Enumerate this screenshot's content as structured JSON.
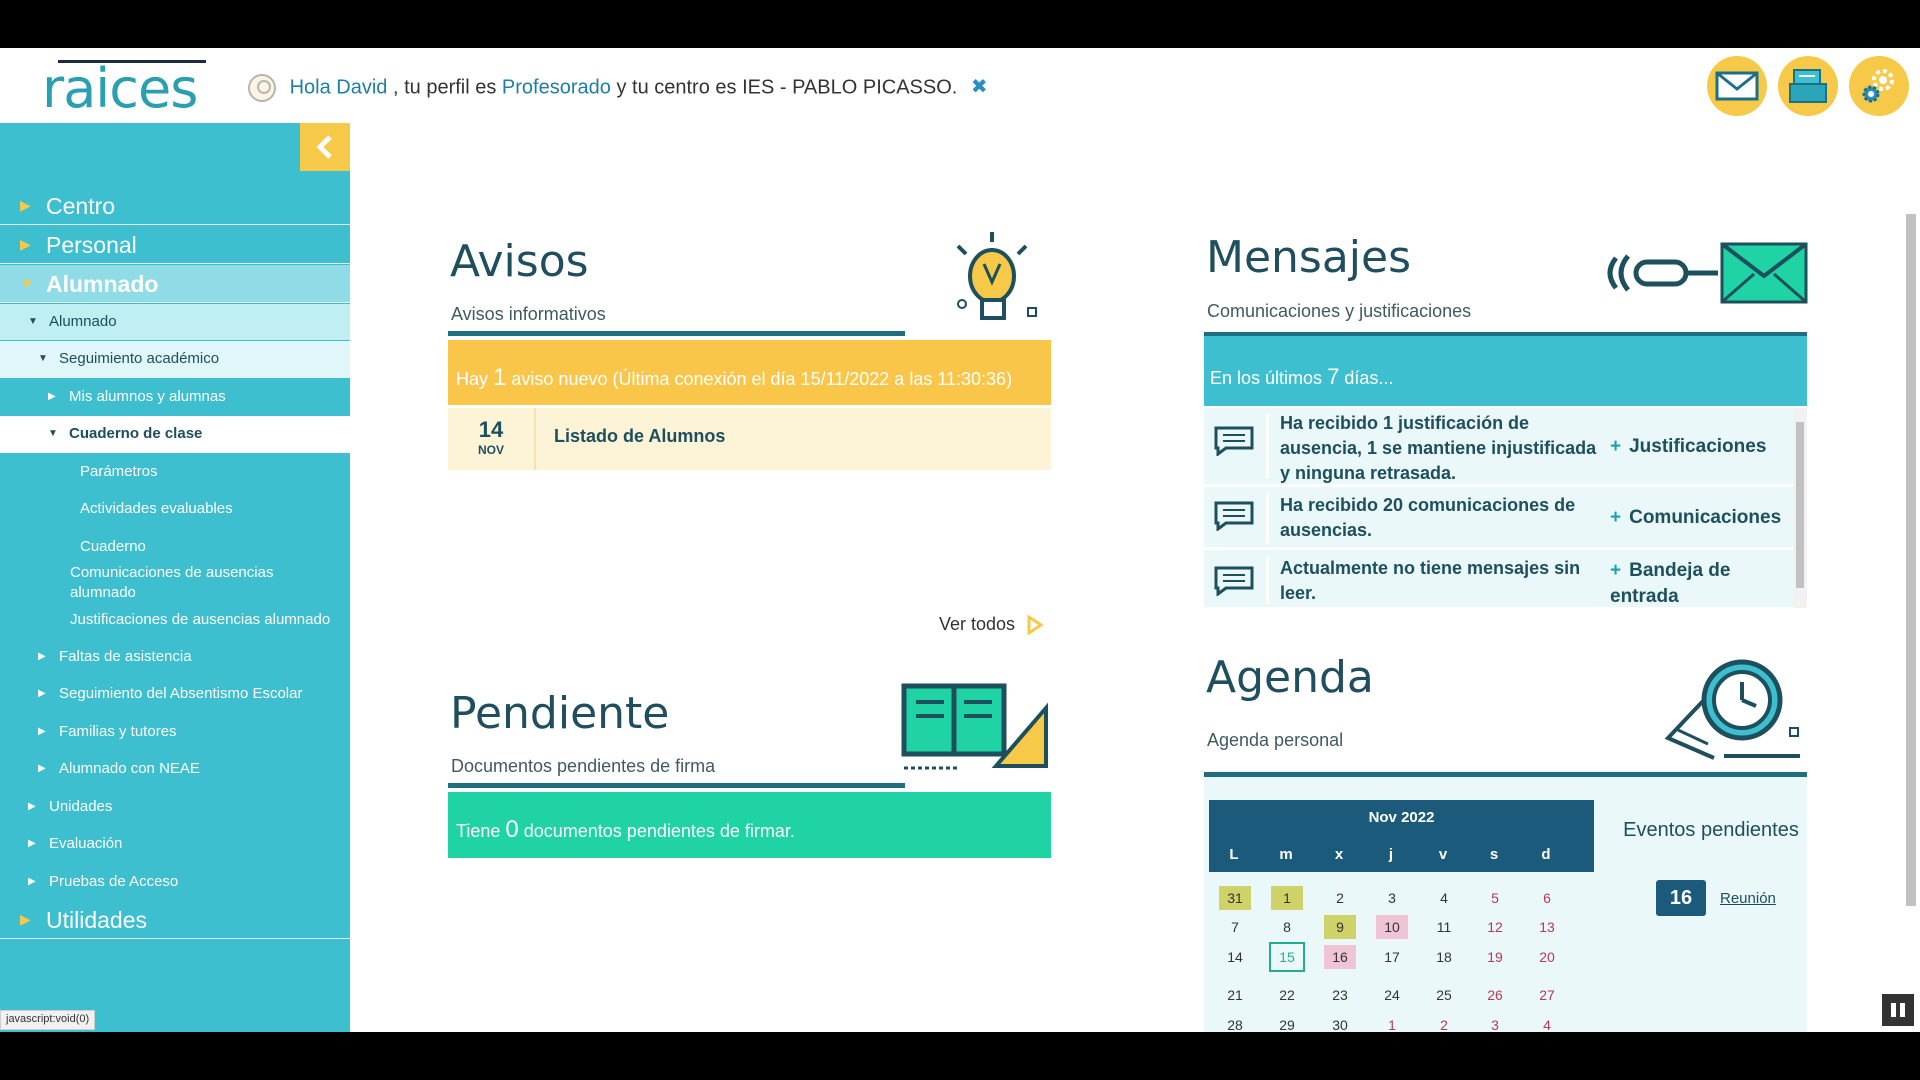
{
  "header": {
    "logo": "raices",
    "greeting_prefix": "Hola",
    "user_name": "David",
    "greeting_mid": ", tu perfil es",
    "profile": "Profesorado",
    "greeting_end": "y tu centro es IES - PABLO PICASSO.",
    "buttons": [
      "mail-icon",
      "documents-icon",
      "settings-icon"
    ]
  },
  "sidebar": {
    "sections": [
      "Centro",
      "Personal",
      "Alumnado",
      "Utilidades"
    ],
    "alumnado_sub": "Alumnado",
    "seguimiento": "Seguimiento académico",
    "mis_alumnos": "Mis alumnos y alumnas",
    "cuaderno_clase": "Cuaderno de clase",
    "parametros": "Parámetros",
    "actividades": "Actividades evaluables",
    "cuaderno": "Cuaderno",
    "comunicaciones": "Comunicaciones de ausencias alumnado",
    "justificaciones": "Justificaciones de ausencias alumnado",
    "faltas": "Faltas de asistencia",
    "absentismo": "Seguimiento del Absentismo Escolar",
    "familias": "Familias y tutores",
    "neae": "Alumnado con NEAE",
    "unidades": "Unidades",
    "evaluacion": "Evaluación",
    "pruebas": "Pruebas de Acceso"
  },
  "status_url": "javascript:void(0)",
  "avisos": {
    "title": "Avisos",
    "subtitle": "Avisos informativos",
    "banner_pre": "Hay",
    "banner_count": "1",
    "banner_post": "aviso nuevo (Última conexión el día 15/11/2022 a las 11:30:36)",
    "item_day": "14",
    "item_month": "NOV",
    "item_text": "Listado de Alumnos",
    "ver_todos": "Ver todos"
  },
  "pendiente": {
    "title": "Pendiente",
    "subtitle": "Documentos pendientes de firma",
    "banner_pre": "Tiene",
    "banner_count": "0",
    "banner_post": "documentos pendientes de firmar."
  },
  "mensajes": {
    "title": "Mensajes",
    "subtitle": "Comunicaciones y justificaciones",
    "banner_pre": "En los últimos",
    "banner_count": "7",
    "banner_post": "días...",
    "rows": [
      {
        "text": "Ha recibido 1 justificación de ausencia, 1 se mantiene injustificada y ninguna retrasada.",
        "link": "Justificaciones"
      },
      {
        "text": "Ha recibido 20 comunicaciones de ausencias.",
        "link": "Comunicaciones"
      },
      {
        "text": "Actualmente no tiene mensajes sin leer.",
        "link": "Bandeja de entrada"
      }
    ]
  },
  "agenda": {
    "title": "Agenda",
    "subtitle": "Agenda personal",
    "month": "Nov 2022",
    "weekdays": [
      "L",
      "m",
      "x",
      "j",
      "v",
      "s",
      "d"
    ],
    "weeks": [
      [
        "31",
        "1",
        "2",
        "3",
        "4",
        "5",
        "6"
      ],
      [
        "7",
        "8",
        "9",
        "10",
        "11",
        "12",
        "13"
      ],
      [
        "14",
        "15",
        "16",
        "17",
        "18",
        "19",
        "20"
      ],
      [
        "21",
        "22",
        "23",
        "24",
        "25",
        "26",
        "27"
      ],
      [
        "28",
        "29",
        "30",
        "1",
        "2",
        "3",
        "4"
      ]
    ],
    "eventos_title": "Eventos pendientes",
    "event_day": "16",
    "event_label": "Reunión"
  }
}
